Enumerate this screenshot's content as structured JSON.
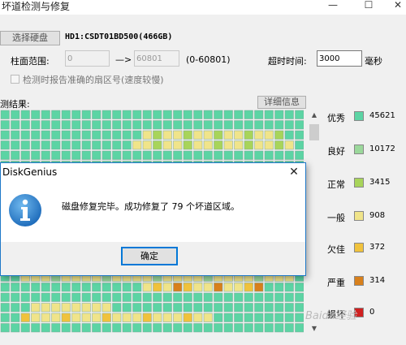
{
  "window": {
    "title": "坏道检测与修复",
    "minimize_glyph": "—",
    "maximize_glyph": "☐",
    "close_glyph": "✕"
  },
  "toolbar": {
    "select_disk_label": "选择硬盘",
    "disk_name": "HD1:CSDT01BD500(466GB)"
  },
  "range": {
    "label": "柱面范围:",
    "start_value": "0",
    "arrow": "—>",
    "end_value": "60801",
    "hint": "(0-60801)",
    "timeout_label": "超时时间:",
    "timeout_value": "3000",
    "timeout_unit": "毫秒"
  },
  "options": {
    "report_sector_label": "检测时报告准确的扇区号(速度较慢)",
    "report_sector_checked": false
  },
  "results": {
    "label": "测结果:",
    "details_button": "详细信息"
  },
  "legend": [
    {
      "label": "优秀",
      "color": "#5cd4a4",
      "count": "45621"
    },
    {
      "label": "良好",
      "color": "#9bd89b",
      "count": "10172"
    },
    {
      "label": "正常",
      "color": "#a8d45a",
      "count": "3415"
    },
    {
      "label": "一般",
      "color": "#f0e48a",
      "count": "908"
    },
    {
      "label": "欠佳",
      "color": "#f0c23c",
      "count": "372"
    },
    {
      "label": "严重",
      "color": "#d8801c",
      "count": "314"
    },
    {
      "label": "损坏",
      "color": "#d02020",
      "count": "0"
    }
  ],
  "dialog": {
    "title": "DiskGenius",
    "close_glyph": "✕",
    "message": "磁盘修复完毕。成功修复了 79 个坏道区域。",
    "ok_label": "确定"
  },
  "scrollbar": {
    "up_glyph": "▲",
    "down_glyph": "▼"
  },
  "watermark": "Baidu经验"
}
